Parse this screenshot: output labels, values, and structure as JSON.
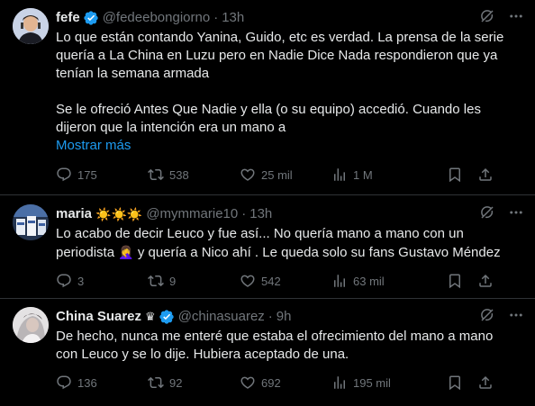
{
  "colors": {
    "background": "#000000",
    "text": "#e7e9ea",
    "muted": "#71767b",
    "link": "#1d9bf0",
    "divider": "#2f3336",
    "verified": "#1d9bf0"
  },
  "tweets": [
    {
      "name": "fefe",
      "handle": "@fedeebongiorno",
      "time": "13h",
      "verified": true,
      "paragraphs": [
        "Lo que están contando Yanina, Guido, etc es verdad. La prensa de la serie quería a La China en Luzu pero en Nadie Dice Nada respondieron que ya tenían la semana armada",
        "Se le ofreció Antes Que Nadie y ella (o su equipo) accedió. Cuando les dijeron que la intención era un mano a"
      ],
      "show_more": "Mostrar más",
      "replies": "175",
      "retweets": "538",
      "likes": "25 mil",
      "views": "1 M"
    },
    {
      "name": "maria",
      "emojis": "☀️☀️☀️",
      "handle": "@mymmarie10",
      "time": "13h",
      "text_a": "Lo acabo de decir Leuco y fue así... No quería mano a mano con un periodista",
      "text_emoji": "🤦‍♀️",
      "text_b": "y quería a Nico ahí . Le queda solo su fans  Gustavo Méndez",
      "replies": "3",
      "retweets": "9",
      "likes": "542",
      "views": "63 mil"
    },
    {
      "name": "China Suarez",
      "crown": "♛",
      "handle": "@chinasuarez",
      "time": "9h",
      "verified": true,
      "text": "De hecho, nunca me enteré que estaba el ofrecimiento del mano a mano con Leuco y se lo dije. Hubiera aceptado de una.",
      "replies": "136",
      "retweets": "92",
      "likes": "692",
      "views": "195 mil"
    }
  ]
}
